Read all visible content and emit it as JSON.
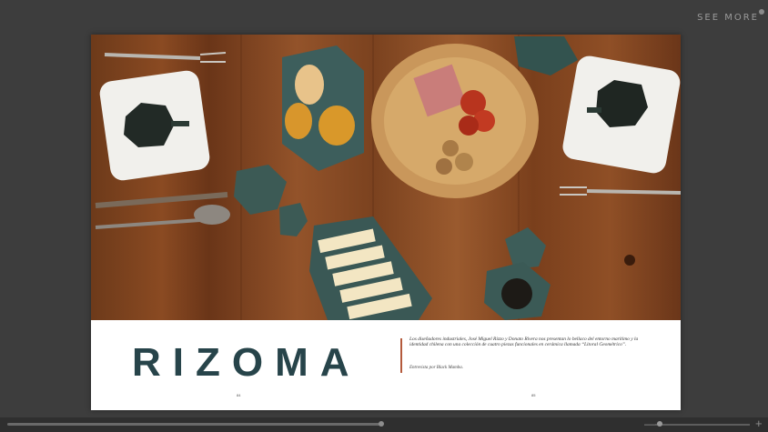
{
  "viewer": {
    "see_more_label": "SEE MORE"
  },
  "magazine": {
    "title": "RIZOMA",
    "description": "Los diseñadores industriales, José Miguel Rizzo y Donato Rivera nos presentan lo bellaco del entorno marítimo y la identidad chilena con una colección de cuatro piezas funcionales en cerámica llamada “Litoral Geométrico”.",
    "credit": "Entrevista por Black Mamba.",
    "page_left": "84",
    "page_right": "85"
  },
  "controls": {
    "zoom_minus": "—",
    "zoom_plus": "+",
    "page_progress": 0.5,
    "zoom_level": 0.02
  },
  "colors": {
    "title": "#27444a",
    "accent_rule": "#b45a3c",
    "background": "#3d3d3d"
  }
}
